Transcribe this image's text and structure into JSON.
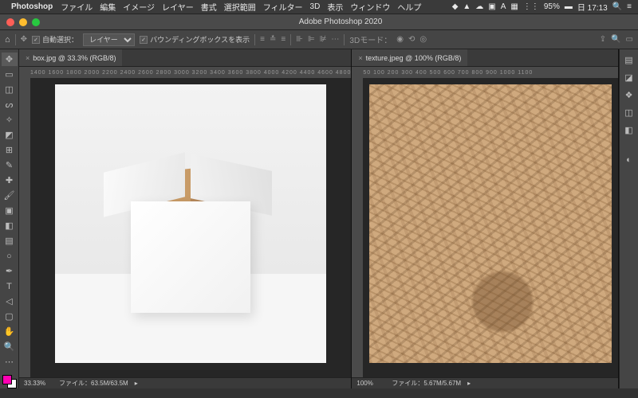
{
  "menubar": {
    "app": "Photoshop",
    "items": [
      "ファイル",
      "編集",
      "イメージ",
      "レイヤー",
      "書式",
      "選択範囲",
      "フィルター",
      "3D",
      "表示",
      "ウィンドウ",
      "ヘルプ"
    ],
    "right": {
      "battery": "95%",
      "time": "日 17:13"
    }
  },
  "titlebar": {
    "title": "Adobe Photoshop 2020"
  },
  "options": {
    "auto_select_label": "自動選択：",
    "auto_select_checked": true,
    "target_dropdown": "レイヤー",
    "bbox_label": "バウンディングボックスを表示",
    "bbox_checked": true,
    "mode_3d": "3Dモード："
  },
  "tools": [
    {
      "name": "move",
      "glyph": "✥",
      "selected": true
    },
    {
      "name": "artboard",
      "glyph": "▭"
    },
    {
      "name": "marquee",
      "glyph": "◫"
    },
    {
      "name": "lasso",
      "glyph": "ᔕ"
    },
    {
      "name": "magic-wand",
      "glyph": "✧"
    },
    {
      "name": "crop",
      "glyph": "◩"
    },
    {
      "name": "frame",
      "glyph": "⊞"
    },
    {
      "name": "eyedropper",
      "glyph": "✎"
    },
    {
      "name": "healing",
      "glyph": "✚"
    },
    {
      "name": "brush",
      "glyph": "🖌"
    },
    {
      "name": "clone",
      "glyph": "▣"
    },
    {
      "name": "eraser",
      "glyph": "◧"
    },
    {
      "name": "gradient",
      "glyph": "▤"
    },
    {
      "name": "dodge",
      "glyph": "○"
    },
    {
      "name": "pen",
      "glyph": "✒"
    },
    {
      "name": "type",
      "glyph": "T"
    },
    {
      "name": "path-select",
      "glyph": "◁"
    },
    {
      "name": "shape",
      "glyph": "▢"
    },
    {
      "name": "hand",
      "glyph": "✋"
    },
    {
      "name": "zoom",
      "glyph": "🔍"
    },
    {
      "name": "more",
      "glyph": "⋯"
    }
  ],
  "docs": [
    {
      "tab_label": "box.jpg @ 33.3% (RGB/8)",
      "ruler_h": "1400 1600 1800 2000 2200 2400 2600 2800 3000 3200 3400 3600 3800 4000 4200 4400 4600 4800",
      "zoom": "33.33%",
      "file_info": "ファイル：63.5M/63.5M"
    },
    {
      "tab_label": "texture.jpeg @ 100% (RGB/8)",
      "ruler_h": "50    100   200   300   400   500   600   700   800   900   1000  1100",
      "zoom": "100%",
      "file_info": "ファイル：5.67M/5.67M"
    }
  ],
  "right_panels": [
    "brush",
    "swatch",
    "layers",
    "history",
    "properties",
    "adjustments",
    "more",
    "libraries"
  ],
  "colors": {
    "fg": "#ff00b3",
    "bg": "#ffffff"
  }
}
